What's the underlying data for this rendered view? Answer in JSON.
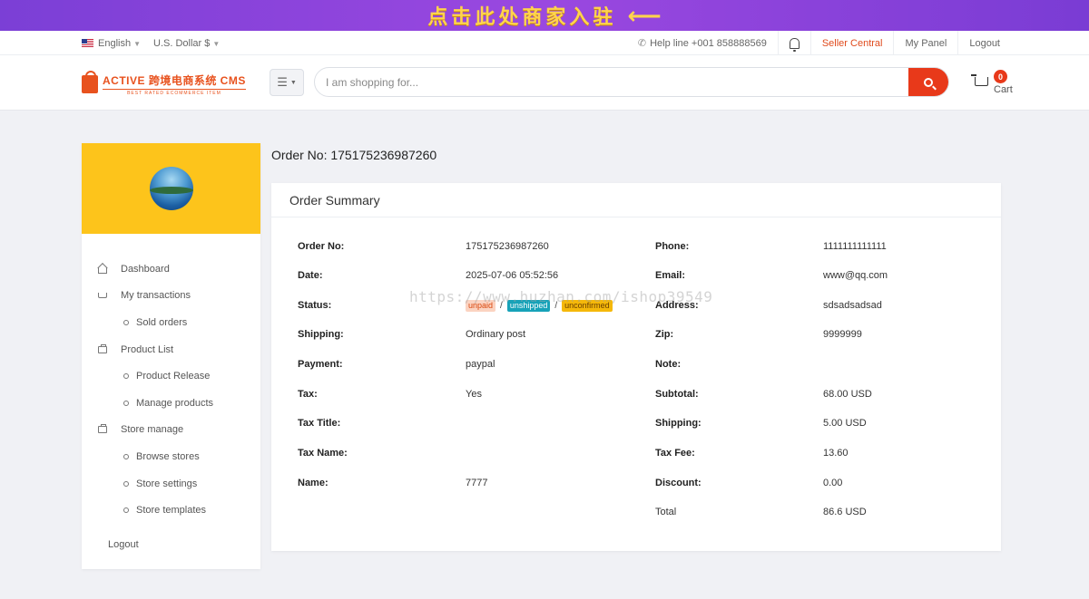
{
  "promo": {
    "text": "点击此处商家入驻",
    "arrow": "⟵"
  },
  "topbar": {
    "language": "English",
    "currency": "U.S. Dollar $",
    "helpline": "Help line +001 858888569",
    "seller_central": "Seller Central",
    "my_panel": "My Panel",
    "logout": "Logout"
  },
  "header": {
    "logo_main": "ACTIVE 跨境电商系统 CMS",
    "logo_sub": "BEST RATED ECOMMERCE ITEM",
    "search_placeholder": "I am shopping for...",
    "cart_count": "0",
    "cart_label": "Cart"
  },
  "sidebar": {
    "items": [
      {
        "label": "Dashboard",
        "type": "main",
        "icon": "home-icon"
      },
      {
        "label": "My transactions",
        "type": "main",
        "icon": "cart-icon"
      },
      {
        "label": "Sold orders",
        "type": "sub"
      },
      {
        "label": "Product List",
        "type": "main",
        "icon": "box-icon"
      },
      {
        "label": "Product Release",
        "type": "sub"
      },
      {
        "label": "Manage products",
        "type": "sub"
      },
      {
        "label": "Store manage",
        "type": "main",
        "icon": "box-icon"
      },
      {
        "label": "Browse stores",
        "type": "sub"
      },
      {
        "label": "Store settings",
        "type": "sub"
      },
      {
        "label": "Store templates",
        "type": "sub"
      }
    ],
    "logout": "Logout"
  },
  "order": {
    "title": "Order No: 175175236987260",
    "card_title": "Order Summary",
    "left": [
      {
        "label": "Order No:",
        "value": "175175236987260"
      },
      {
        "label": "Date:",
        "value": "2025-07-06 05:52:56"
      },
      {
        "label": "Status:",
        "value": ""
      },
      {
        "label": "Shipping:",
        "value": "Ordinary post"
      },
      {
        "label": "Payment:",
        "value": "paypal"
      },
      {
        "label": "Tax:",
        "value": "Yes"
      },
      {
        "label": "Tax Title:",
        "value": ""
      },
      {
        "label": "Tax Name:",
        "value": ""
      },
      {
        "label": "Name:",
        "value": "7777"
      }
    ],
    "right": [
      {
        "label": "Phone:",
        "value": "1111111111111"
      },
      {
        "label": "Email:",
        "value": "www@qq.com"
      },
      {
        "label": "Address:",
        "value": "sdsadsadsad"
      },
      {
        "label": "Zip:",
        "value": "9999999"
      },
      {
        "label": "Note:",
        "value": ""
      },
      {
        "label": "Subtotal:",
        "value": "68.00 USD"
      },
      {
        "label": "Shipping:",
        "value": "5.00 USD"
      },
      {
        "label": "Tax Fee:",
        "value": "13.60"
      },
      {
        "label": "Discount:",
        "value": "0.00"
      },
      {
        "label": "Total",
        "value": "86.6 USD"
      }
    ],
    "status_badges": [
      "unpaid",
      "unshipped",
      "unconfirmed"
    ],
    "status_separator": "/"
  },
  "watermark": "https://www.huzhan.com/ishop39549"
}
